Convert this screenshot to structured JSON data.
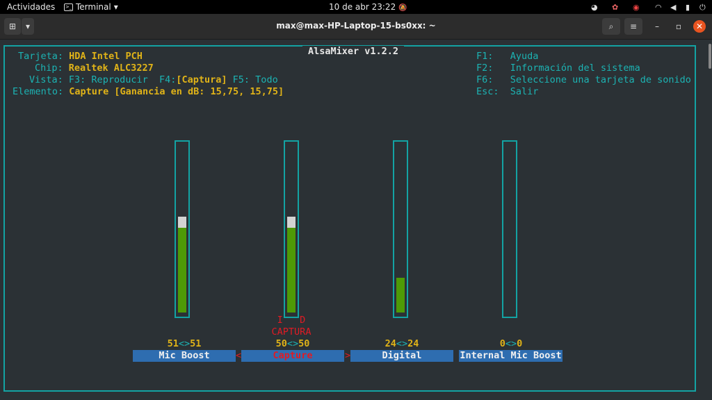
{
  "topbar": {
    "activities": "Actividades",
    "app_name": "Terminal",
    "app_arrow": "▾",
    "clock": "10 de abr  23:22",
    "bell_icon": "🔕",
    "tray_icons": [
      "discord-icon",
      "app-icon",
      "chrome-icon",
      "wifi-icon",
      "volume-icon",
      "battery-icon",
      "power-icon"
    ]
  },
  "window": {
    "title": "max@max-HP-Laptop-15-bs0xx: ~",
    "newtab_glyph": "⊞",
    "dropdown_glyph": "▾",
    "search_glyph": "⌕",
    "menu_glyph": "≡",
    "min_glyph": "–",
    "max_glyph": "▫",
    "close_glyph": "✕"
  },
  "alsamixer": {
    "title": "AlsaMixer v1.2.2",
    "info": {
      "card_label": "Tarjeta:",
      "card_value": "HDA Intel PCH",
      "chip_label": "Chip:",
      "chip_value": "Realtek ALC3227",
      "view_label": "Vista:",
      "view_f3": "F3: Reproducir",
      "view_f4_key": "F4:",
      "view_f4_value": "[Captura]",
      "view_f5": "F5: Todo",
      "element_label": "Elemento:",
      "element_value": "Capture [Ganancia en dB: 15,75, 15,75]"
    },
    "help": [
      {
        "key": "F1:",
        "text": "Ayuda"
      },
      {
        "key": "F2:",
        "text": "Información del sistema"
      },
      {
        "key": "F6:",
        "text": "Seleccione una tarjeta de sonido"
      },
      {
        "key": "Esc:",
        "text": "Salir"
      }
    ],
    "controls": [
      {
        "name": "Mic Boost",
        "volume": "51<>51",
        "left": "51",
        "right": "51",
        "level": 0.51,
        "cap": true
      },
      {
        "name": "Capture",
        "volume": "50<>50",
        "left": "50",
        "right": "50",
        "level": 0.51,
        "cap": true,
        "selected": true,
        "capture_flags": "I   D",
        "capture_label": "CAPTURA"
      },
      {
        "name": "Digital",
        "volume": "24<>24",
        "left": "24",
        "right": "24",
        "level": 0.21,
        "cap": false
      },
      {
        "name": "Internal Mic Boost",
        "volume": "0<>0",
        "left": "0",
        "right": "0",
        "level": 0.0,
        "cap": false
      }
    ],
    "select_left": "<",
    "select_right": ">",
    "sep": "<>"
  },
  "colors": {
    "accent": "#13a3a3",
    "value": "#e0b318",
    "bar": "#4e9a06",
    "label_bg": "#2e6db0",
    "close": "#e95420"
  }
}
